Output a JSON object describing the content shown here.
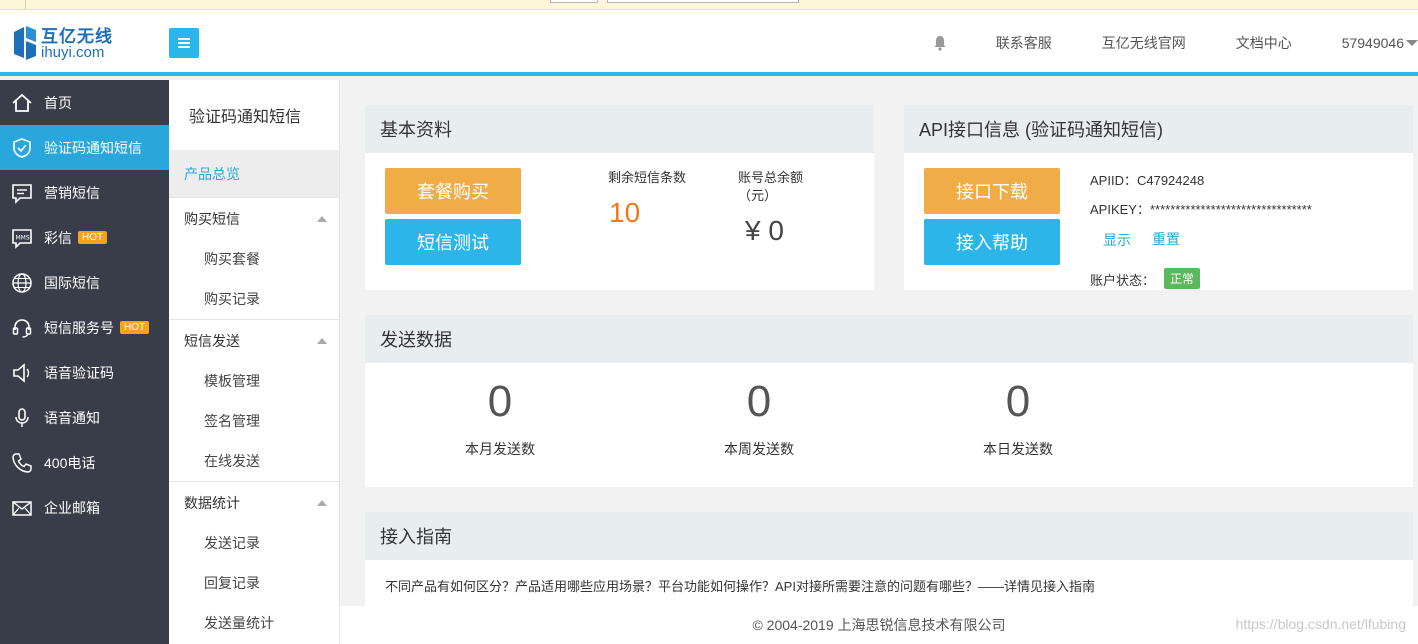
{
  "header": {
    "logo_cn": "互亿无线",
    "logo_en": "ihuyi.com",
    "nav": [
      "联系客服",
      "互亿无线官网",
      "文档中心"
    ],
    "user": "57949046"
  },
  "sidebar": {
    "items": [
      {
        "label": "首页",
        "icon": "home-icon",
        "hot": false,
        "active": false
      },
      {
        "label": "验证码通知短信",
        "icon": "shield-icon",
        "hot": false,
        "active": true
      },
      {
        "label": "营销短信",
        "icon": "message-icon",
        "hot": false,
        "active": false
      },
      {
        "label": "彩信",
        "icon": "mms-icon",
        "hot": true,
        "active": false
      },
      {
        "label": "国际短信",
        "icon": "globe-icon",
        "hot": false,
        "active": false
      },
      {
        "label": "短信服务号",
        "icon": "headset-icon",
        "hot": true,
        "active": false
      },
      {
        "label": "语音验证码",
        "icon": "speaker-icon",
        "hot": false,
        "active": false
      },
      {
        "label": "语音通知",
        "icon": "microphone-icon",
        "hot": false,
        "active": false
      },
      {
        "label": "400电话",
        "icon": "phone-icon",
        "hot": false,
        "active": false
      },
      {
        "label": "企业邮箱",
        "icon": "mail-icon",
        "hot": false,
        "active": false
      }
    ],
    "hot_label": "HOT"
  },
  "subnav": {
    "title": "验证码通知短信",
    "overview": "产品总览",
    "groups": [
      {
        "label": "购买短信",
        "items": [
          "购买套餐",
          "购买记录"
        ]
      },
      {
        "label": "短信发送",
        "items": [
          "模板管理",
          "签名管理",
          "在线发送"
        ]
      },
      {
        "label": "数据统计",
        "items": [
          "发送记录",
          "回复记录",
          "发送量统计"
        ]
      }
    ]
  },
  "basic": {
    "title": "基本资料",
    "buy_button": "套餐购买",
    "test_button": "短信测试",
    "remaining_label": "剩余短信条数",
    "remaining_value": "10",
    "balance_label": "账号总余额（元）",
    "balance_value": "¥ 0"
  },
  "api": {
    "title": "API接口信息 (验证码通知短信)",
    "download_button": "接口下载",
    "help_button": "接入帮助",
    "apiid_label": "APIID：",
    "apiid_value": "C47924248",
    "apikey_label": "APIKEY：",
    "apikey_value": "********************************",
    "show_link": "显示",
    "reset_link": "重置",
    "status_label": "账户状态：",
    "status_value": "正常"
  },
  "send_data": {
    "title": "发送数据",
    "stats": [
      {
        "value": "0",
        "label": "本月发送数"
      },
      {
        "value": "0",
        "label": "本周发送数"
      },
      {
        "value": "0",
        "label": "本日发送数"
      }
    ]
  },
  "guide": {
    "title": "接入指南",
    "text": "不同产品有如何区分？产品适用哪些应用场景？平台功能如何操作？API对接所需要注意的问题有哪些？——详情见接入指南"
  },
  "footer": {
    "copyright": "© 2004-2019 上海思锐信息技术有限公司",
    "watermark": "https://blog.csdn.net/lfubing"
  },
  "colors": {
    "accent": "#29b6e8",
    "sidebar_bg": "#393d49",
    "orange_button": "#f0ac46",
    "remaining_number": "#f07a1a",
    "status_green": "#5cb85c"
  }
}
